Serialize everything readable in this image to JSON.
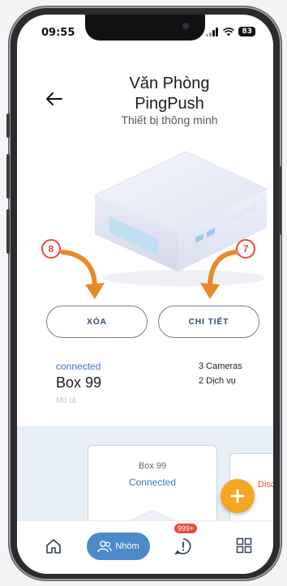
{
  "status_bar": {
    "time": "09:55",
    "battery": "83"
  },
  "header": {
    "title_line1": "Văn Phòng",
    "title_line2": "PingPush",
    "subtitle": "Thiết bị thông minh"
  },
  "actions": {
    "delete_label": "XÓA",
    "delete_marker": "8",
    "detail_label": "CHI TIẾT",
    "detail_marker": "7"
  },
  "device_info": {
    "status": "connected",
    "name": "Box 99",
    "description": "Mô tả",
    "cameras": "3 Cameras",
    "services": "2 Dịch vụ"
  },
  "device_cards": [
    {
      "name": "Box 99",
      "status": "Connected"
    },
    {
      "status": "Disco"
    }
  ],
  "tabbar": {
    "group_label": "Nhóm",
    "alerts_badge": "999+"
  },
  "colors": {
    "accent": "#4d8ac9",
    "fab": "#f5a623",
    "annotation": "#e74b3c",
    "arrow": "#e8892a"
  }
}
